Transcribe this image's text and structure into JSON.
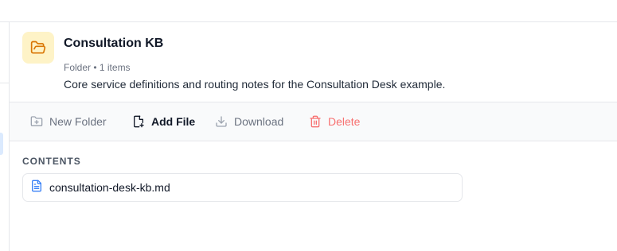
{
  "folder": {
    "icon": "folder-open-icon",
    "title": "Consultation KB",
    "meta": "Folder • 1 items",
    "description": "Core service definitions and routing notes for the Consultation Desk example."
  },
  "toolbar": {
    "new_folder_label": "New Folder",
    "add_file_label": "Add File",
    "download_label": "Download",
    "delete_label": "Delete",
    "icons": {
      "new_folder": "folder-plus-icon",
      "add_file": "file-plus-icon",
      "download": "download-icon",
      "delete": "trash-icon"
    }
  },
  "contents": {
    "heading": "CONTENTS",
    "items": [
      {
        "name": "consultation-desk-kb.md",
        "icon": "file-text-icon"
      }
    ]
  },
  "colors": {
    "folder_badge_bg": "#fef3c7",
    "folder_icon": "#d97706",
    "delete": "#f87171",
    "file_icon": "#3b82f6",
    "border": "#e5e7eb",
    "toolbar_bg": "#f9fafb"
  }
}
